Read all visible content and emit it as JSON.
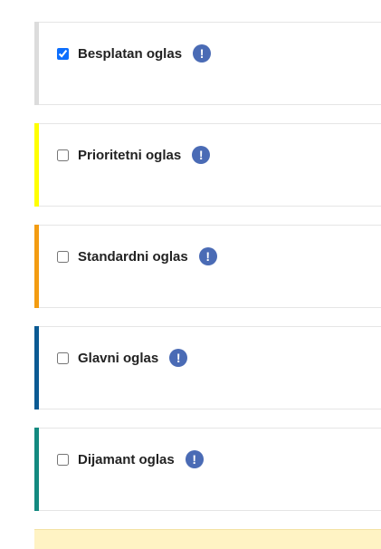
{
  "plans": [
    {
      "label": "Besplatan oglas",
      "checked": true,
      "accent": "#dcdcdc",
      "info_icon": "exclamation-circle-icon",
      "info_glyph": "!"
    },
    {
      "label": "Prioritetni oglas",
      "checked": false,
      "accent": "#ffff00",
      "info_icon": "exclamation-circle-icon",
      "info_glyph": "!"
    },
    {
      "label": "Standardni oglas",
      "checked": false,
      "accent": "#f39c12",
      "info_icon": "exclamation-circle-icon",
      "info_glyph": "!"
    },
    {
      "label": "Glavni oglas",
      "checked": false,
      "accent": "#0b5a93",
      "info_icon": "exclamation-circle-icon",
      "info_glyph": "!"
    },
    {
      "label": "Dijamant oglas",
      "checked": false,
      "accent": "#138a80",
      "info_icon": "exclamation-circle-icon",
      "info_glyph": "!"
    }
  ],
  "colors": {
    "info_icon_bg": "#4a6bb5",
    "notice_bg": "#fff3c4"
  }
}
